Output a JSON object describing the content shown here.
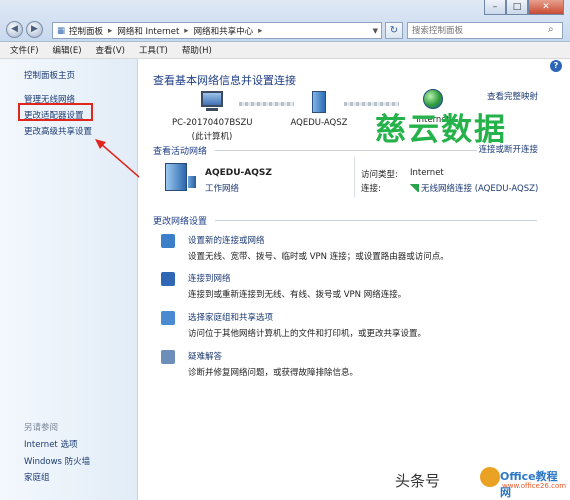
{
  "window": {
    "controls": [
      "–",
      "□",
      "✕"
    ],
    "breadcrumb": [
      "控制面板",
      "网络和 Internet",
      "网络和共享中心"
    ],
    "search_placeholder": "搜索控制面板"
  },
  "menu": [
    "文件(F)",
    "编辑(E)",
    "查看(V)",
    "工具(T)",
    "帮助(H)"
  ],
  "sidebar": {
    "items": [
      {
        "label": "控制面板主页"
      },
      {
        "label": "管理无线网络"
      },
      {
        "label": "更改适配器设置"
      },
      {
        "label": "更改高级共享设置"
      }
    ],
    "see_also_title": "另请参阅",
    "see_also": [
      {
        "label": "Internet 选项"
      },
      {
        "label": "Windows 防火墙"
      },
      {
        "label": "家庭组"
      }
    ]
  },
  "main": {
    "title": "查看基本网络信息并设置连接",
    "view_full_map": "查看完整映射",
    "nodes": [
      {
        "name": "PC-20170407BSZU",
        "sub": "(此计算机)"
      },
      {
        "name": "AQEDU-AQSZ",
        "sub": ""
      },
      {
        "name": "Internet",
        "sub": ""
      }
    ],
    "active_label": "查看活动网络",
    "connect_link": "连接或断开连接",
    "network": {
      "name": "AQEDU-AQSZ",
      "type": "工作网络",
      "access_label": "访问类型:",
      "access_value": "Internet",
      "connections_label": "连接:",
      "connections_value": "无线网络连接 (AQEDU-AQSZ)"
    },
    "change_label": "更改网络设置",
    "tasks": [
      {
        "title": "设置新的连接或网络",
        "desc": "设置无线、宽带、拨号、临时或 VPN 连接；或设置路由器或访问点。",
        "color": "#3b7fc9"
      },
      {
        "title": "连接到网络",
        "desc": "连接到或重新连接到无线、有线、拨号或 VPN 网络连接。",
        "color": "#2f67b4"
      },
      {
        "title": "选择家庭组和共享选项",
        "desc": "访问位于其他网络计算机上的文件和打印机，或更改共享设置。",
        "color": "#4a8ad1"
      },
      {
        "title": "疑难解答",
        "desc": "诊断并修复网络问题，或获得故障排除信息。",
        "color": "#6b8fb8"
      }
    ]
  },
  "watermarks": {
    "center": "慈云数据",
    "toutiao": "头条号",
    "office_a": "Office教程网",
    "office_b": "www.office26.com"
  }
}
